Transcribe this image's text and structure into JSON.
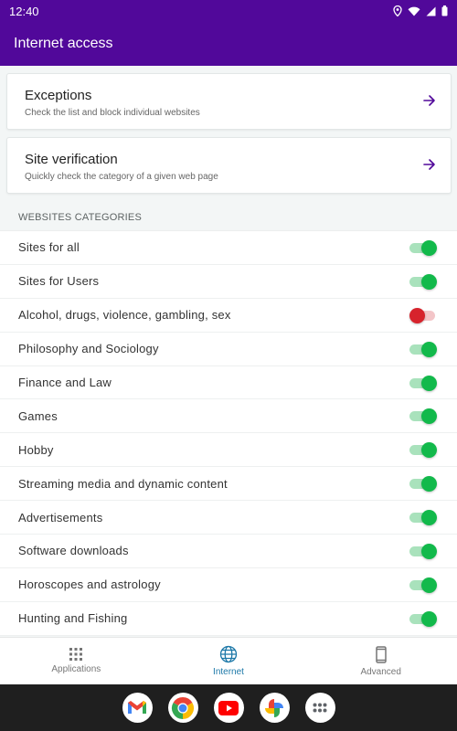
{
  "status_bar": {
    "time": "12:40"
  },
  "app_bar": {
    "title": "Internet access"
  },
  "cards": [
    {
      "title": "Exceptions",
      "subtitle": "Check the list and block individual websites"
    },
    {
      "title": "Site verification",
      "subtitle": "Quickly check the category of a given web page"
    }
  ],
  "section": {
    "header": "WEBSITES CATEGORIES"
  },
  "categories": [
    {
      "label": "Sites for all",
      "enabled": true
    },
    {
      "label": "Sites for Users",
      "enabled": true
    },
    {
      "label": "Alcohol, drugs, violence, gambling, sex",
      "enabled": false
    },
    {
      "label": "Philosophy and Sociology",
      "enabled": true
    },
    {
      "label": "Finance and Law",
      "enabled": true
    },
    {
      "label": "Games",
      "enabled": true
    },
    {
      "label": "Hobby",
      "enabled": true
    },
    {
      "label": "Streaming media and dynamic content",
      "enabled": true
    },
    {
      "label": "Advertisements",
      "enabled": true
    },
    {
      "label": "Software downloads",
      "enabled": true
    },
    {
      "label": "Horoscopes and astrology",
      "enabled": true
    },
    {
      "label": "Hunting and Fishing",
      "enabled": true
    }
  ],
  "bottom_nav": [
    {
      "label": "Applications",
      "icon": "grid-icon",
      "active": false
    },
    {
      "label": "Internet",
      "icon": "globe-icon",
      "active": true
    },
    {
      "label": "Advanced",
      "icon": "phone-icon",
      "active": false
    }
  ],
  "dock": [
    "gmail-icon",
    "chrome-icon",
    "youtube-icon",
    "photos-icon",
    "app-drawer-icon"
  ],
  "colors": {
    "primary": "#51089a",
    "switch_on": "#12b94b",
    "switch_off": "#d7232c",
    "nav_active": "#1c78a8"
  }
}
